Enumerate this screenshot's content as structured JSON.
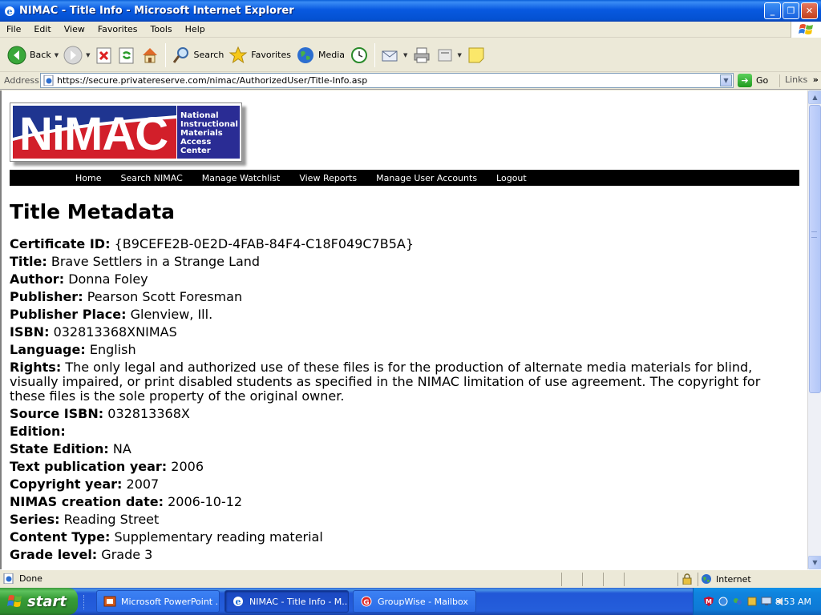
{
  "window": {
    "title": "NIMAC - Title Info - Microsoft Internet Explorer",
    "minimize": "_",
    "restore": "❐",
    "close": "✕"
  },
  "menu": [
    "File",
    "Edit",
    "View",
    "Favorites",
    "Tools",
    "Help"
  ],
  "toolbar": {
    "back": "Back",
    "search": "Search",
    "favorites": "Favorites",
    "media": "Media"
  },
  "address": {
    "label": "Address",
    "url": "https://secure.privatereserve.com/nimac/AuthorizedUser/Title-Info.asp",
    "go": "Go",
    "links": "Links"
  },
  "logo": {
    "word": "NiMAC",
    "lines": [
      "National",
      "Instructional",
      "Materials",
      "Access",
      "Center"
    ]
  },
  "nav": [
    "Home",
    "Search NIMAC",
    "Manage Watchlist",
    "View Reports",
    "Manage User Accounts",
    "Logout"
  ],
  "heading": "Title Metadata",
  "fields": [
    {
      "label": "Certificate ID:",
      "value": "{B9CEFE2B-0E2D-4FAB-84F4-C18F049C7B5A}"
    },
    {
      "label": "Title:",
      "value": "Brave Settlers in a Strange Land"
    },
    {
      "label": "Author:",
      "value": "Donna Foley"
    },
    {
      "label": "Publisher:",
      "value": "Pearson Scott Foresman"
    },
    {
      "label": "Publisher Place:",
      "value": "Glenview, Ill."
    },
    {
      "label": "ISBN:",
      "value": "032813368XNIMAS"
    },
    {
      "label": "Language:",
      "value": "English"
    },
    {
      "label": "Rights:",
      "value": "The only legal and authorized use of these files is for the production of alternate media materials for blind, visually impaired, or print disabled students as specified in the NIMAC limitation of use agreement. The copyright for these files is the sole property of the original owner."
    },
    {
      "label": "Source ISBN:",
      "value": "032813368X"
    },
    {
      "label": "Edition:",
      "value": ""
    },
    {
      "label": "State Edition:",
      "value": "NA"
    },
    {
      "label": "Text publication year:",
      "value": "2006"
    },
    {
      "label": "Copyright year:",
      "value": "2007"
    },
    {
      "label": "NIMAS creation date:",
      "value": "2006-10-12"
    },
    {
      "label": "Series:",
      "value": "Reading Street"
    },
    {
      "label": "Content Type:",
      "value": "Supplementary reading material"
    },
    {
      "label": "Grade level:",
      "value": "Grade 3"
    }
  ],
  "status": {
    "text": "Done",
    "zone": "Internet"
  },
  "taskbar": {
    "start": "start",
    "tasks": [
      "Microsoft PowerPoint ...",
      "NIMAC - Title Info - M...",
      "GroupWise - Mailbox"
    ],
    "clock": "8:53 AM"
  },
  "colors": {
    "nav_bg": "#000000",
    "logo_blue": "#1f3590",
    "logo_red": "#d21f2a",
    "titlebar": "#0859e0",
    "taskbar": "#245edb",
    "start_green": "#379d37"
  }
}
